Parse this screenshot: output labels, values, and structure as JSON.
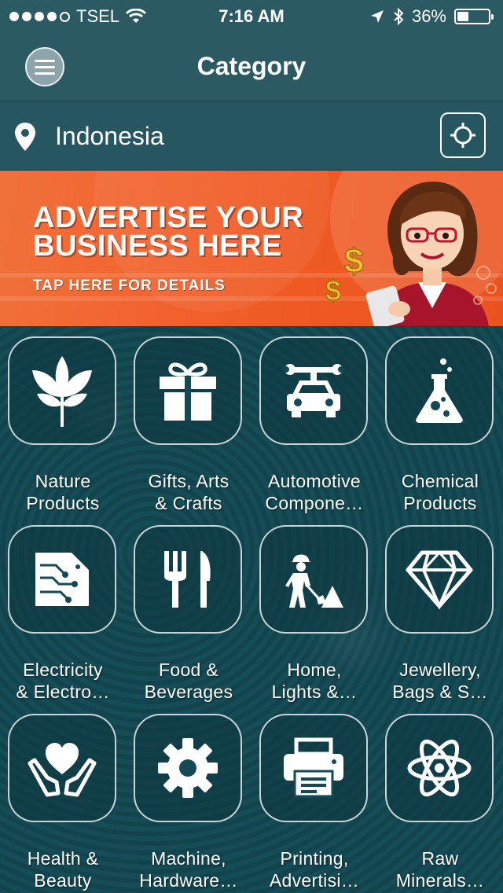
{
  "status_bar": {
    "carrier": "TSEL",
    "time": "7:16 AM",
    "battery": "36%",
    "signal_bars_filled": 4,
    "signal_bars_total": 5,
    "battery_level": 0.36
  },
  "navbar": {
    "title": "Category",
    "menu_icon": "hamburger-menu-icon"
  },
  "location": {
    "value": "Indonesia",
    "pin_icon": "location-pin-icon",
    "gps_icon": "crosshair-gps-icon"
  },
  "banner": {
    "title_line1": "ADVERTISE YOUR",
    "title_line2": "BUSINESS HERE",
    "subtitle": "TAP HERE FOR DETAILS"
  },
  "categories": [
    {
      "line1": "Nature",
      "line2": "Products",
      "icon": "leaf-icon"
    },
    {
      "line1": "Gifts, Arts",
      "line2": "& Crafts",
      "icon": "gift-icon"
    },
    {
      "line1": "Automotive",
      "line2": "Compone…",
      "icon": "car-wrench-icon"
    },
    {
      "line1": "Chemical",
      "line2": "Products",
      "icon": "flask-icon"
    },
    {
      "line1": "Electricity",
      "line2": "& Electro…",
      "icon": "circuit-board-icon"
    },
    {
      "line1": "Food &",
      "line2": "Beverages",
      "icon": "fork-knife-icon"
    },
    {
      "line1": "Home,",
      "line2": "Lights &…",
      "icon": "construction-worker-icon"
    },
    {
      "line1": "Jewellery,",
      "line2": "Bags & S…",
      "icon": "diamond-icon"
    },
    {
      "line1": "Health &",
      "line2": "Beauty",
      "icon": "heart-hands-icon"
    },
    {
      "line1": "Machine,",
      "line2": "Hardware…",
      "icon": "gear-icon"
    },
    {
      "line1": "Printing,",
      "line2": "Advertisi…",
      "icon": "printer-icon"
    },
    {
      "line1": "Raw",
      "line2": "Minerals…",
      "icon": "atom-icon"
    }
  ],
  "colors": {
    "header_bg": "#2b5a63",
    "banner_orange": "#f2622e",
    "grid_bg": "#134650"
  }
}
